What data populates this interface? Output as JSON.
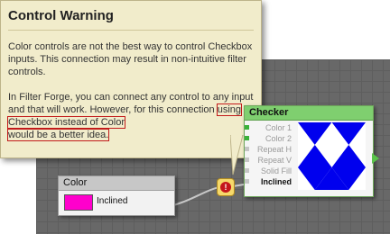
{
  "tooltip": {
    "title": "Control Warning",
    "paragraph1": "Color controls are not the best way to control Checkbox inputs. This connection may result in non-intuitive filter controls.",
    "paragraph2_pre": "In Filter Forge, you can connect any control to any input and that will work. However, for this connection",
    "paragraph2_hl1": "using Checkbox instead of Color",
    "paragraph2_hl2": "would be a better idea."
  },
  "checker_node": {
    "title": "Checker",
    "inputs": [
      "Color 1",
      "Color 2",
      "Repeat H",
      "Repeat V",
      "Solid Fill",
      "Inclined"
    ],
    "colors": {
      "header": "#7fcf6f",
      "pattern": "#0000ee"
    }
  },
  "color_node": {
    "title": "Color",
    "label": "Inclined",
    "swatch": "#ff00cc"
  },
  "warning": {
    "glyph": "!",
    "icon": "warning-icon"
  }
}
